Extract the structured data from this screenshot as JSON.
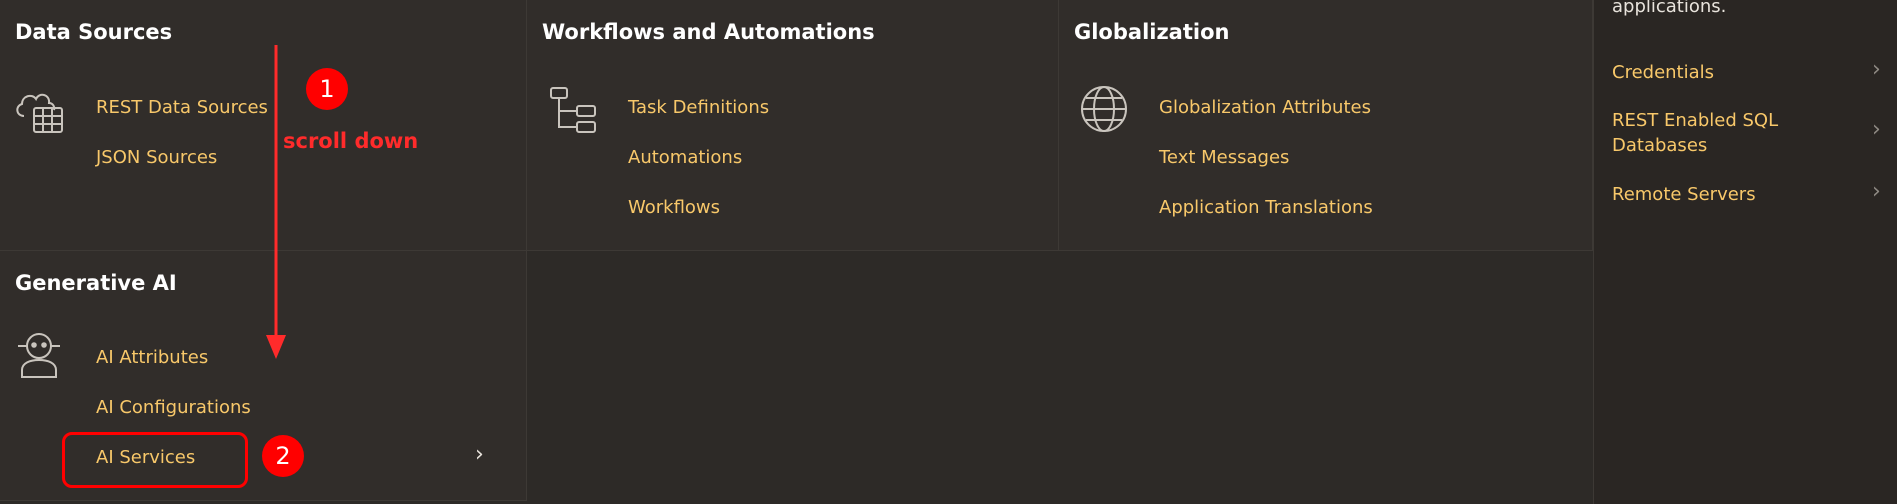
{
  "panels": {
    "data_sources": {
      "title": "Data Sources",
      "icon": "cloud-table-icon",
      "links": [
        "REST Data Sources",
        "JSON Sources"
      ]
    },
    "workflows": {
      "title": "Workflows and Automations",
      "icon": "tree-nodes-icon",
      "links": [
        "Task Definitions",
        "Automations",
        "Workflows"
      ]
    },
    "globalization": {
      "title": "Globalization",
      "icon": "globe-icon",
      "links": [
        "Globalization Attributes",
        "Text Messages",
        "Application Translations"
      ]
    },
    "generative_ai": {
      "title": "Generative AI",
      "icon": "ai-robot-icon",
      "links": [
        "AI Attributes",
        "AI Configurations",
        "AI Services"
      ]
    }
  },
  "right_pane": {
    "top_text": "applications.",
    "links": [
      "Credentials",
      "REST Enabled SQL Databases",
      "Remote Servers"
    ]
  },
  "annotations": {
    "step1_label": "1",
    "step1_text": "scroll down",
    "step2_label": "2",
    "color": "#ff0000"
  },
  "colors": {
    "background": "#312d2a",
    "link": "#f8c86a",
    "title": "#ffffff"
  }
}
